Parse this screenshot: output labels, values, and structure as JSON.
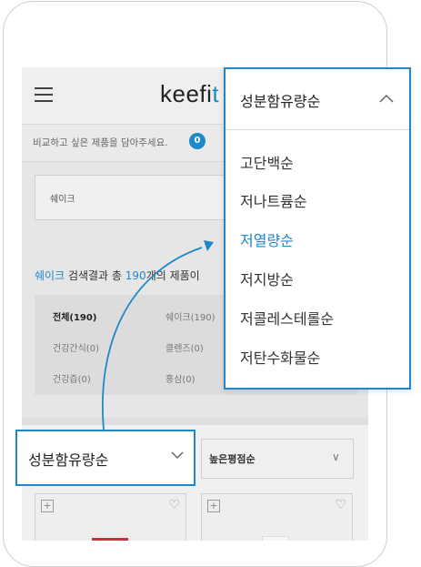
{
  "app": {
    "logo_text": "keefi",
    "logo_accent": "t",
    "compare_text": "비교하고 싶은 제품을 담아주세요.",
    "compare_count": "0",
    "search_text": "쉐이크"
  },
  "results": {
    "keyword": "쉐이크",
    "middle": " 검색결과 총 ",
    "count": "190",
    "suffix": "개의 제품이"
  },
  "categories": [
    {
      "label": "전체(190)",
      "active": true
    },
    {
      "label": "쉐이크(190)",
      "active": false
    },
    {
      "label": "건강간식(0)",
      "active": false
    },
    {
      "label": "클렌즈(0)",
      "active": false
    },
    {
      "label": "건강즙(0)",
      "active": false
    },
    {
      "label": "홍삼(0)",
      "active": false
    }
  ],
  "sort": {
    "selected": "성분함유량순",
    "secondary": "높은평점순"
  },
  "dropdown": {
    "header": "성분함유량순",
    "options": [
      {
        "label": "고단백순",
        "selected": false
      },
      {
        "label": "저나트륨순",
        "selected": false
      },
      {
        "label": "저열량순",
        "selected": true
      },
      {
        "label": "저지방순",
        "selected": false
      },
      {
        "label": "저콜레스테롤순",
        "selected": false
      },
      {
        "label": "저탄수화물순",
        "selected": false
      }
    ]
  },
  "colors": {
    "accent": "#1e88c8"
  }
}
